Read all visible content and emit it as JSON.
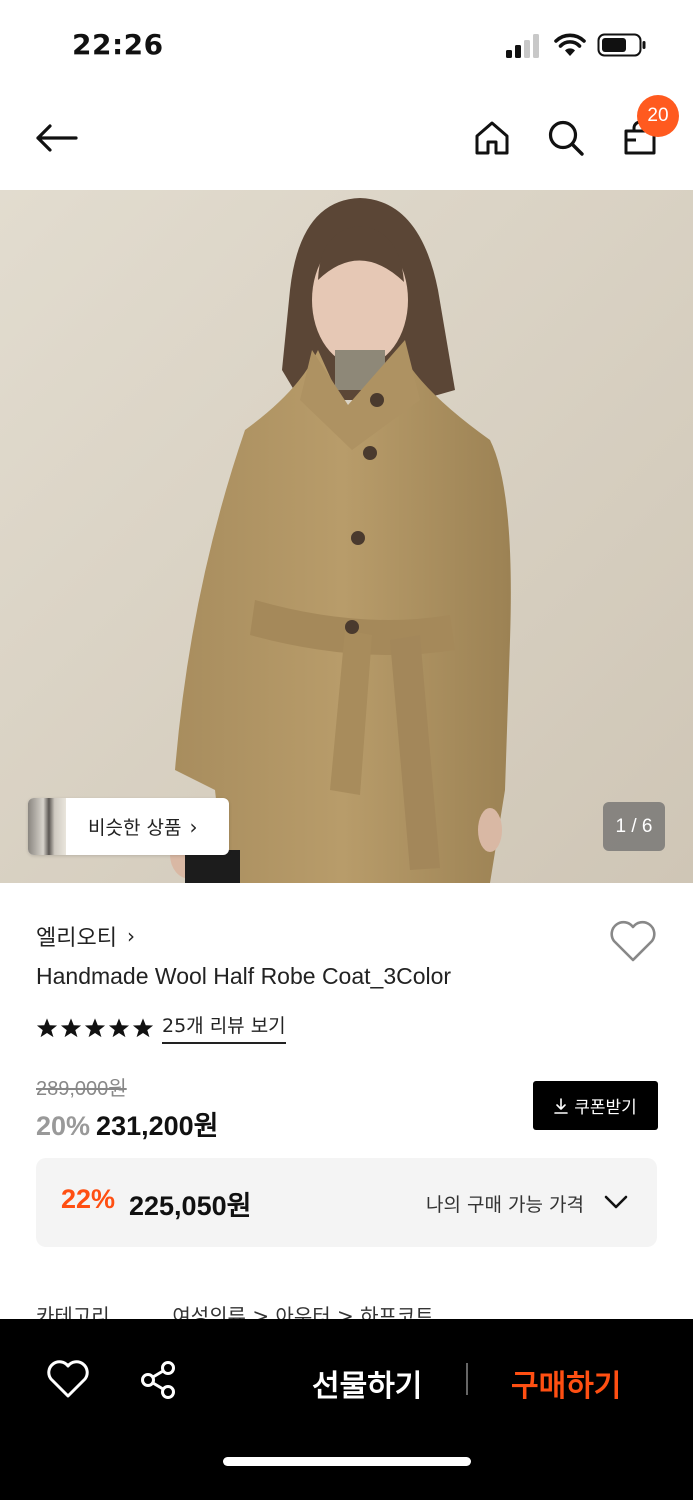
{
  "status_bar": {
    "time": "22:26"
  },
  "header": {
    "cart_count": "20",
    "icons": [
      "back-arrow-icon",
      "home-icon",
      "search-icon",
      "shopping-bag-icon"
    ]
  },
  "gallery": {
    "similar_label": "비슷한 상품",
    "similar_chevron": "›",
    "page_indicator": "1 / 6"
  },
  "product": {
    "brand": "엘리오티",
    "brand_chevron": "›",
    "name": "Handmade Wool Half Robe Coat_3Color",
    "rating_stars": 5,
    "review_link": "25개 리뷰 보기",
    "original_price": "289,000원",
    "discount_pct": "20%",
    "sale_price": "231,200원",
    "coupon_label": "쿠폰받기",
    "best_discount_pct": "22%",
    "best_price": "225,050원",
    "best_price_label": "나의 구매 가능 가격",
    "category_label": "카테고리",
    "category_path": "여성의류 > 아우터 > 하프코트"
  },
  "bottom_bar": {
    "gift_label": "선물하기",
    "buy_label": "구매하기"
  },
  "colors": {
    "accent": "#ff4f12",
    "badge": "#ff5a1f",
    "bottom_bar_bg": "#000000"
  }
}
